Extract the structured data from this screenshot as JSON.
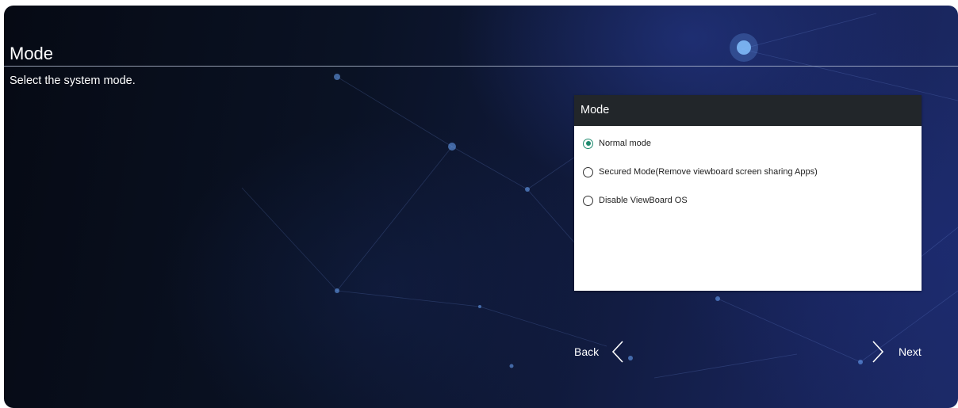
{
  "page": {
    "title": "Mode",
    "subtitle": "Select the system mode."
  },
  "dialog": {
    "title": "Mode",
    "options": [
      {
        "label": "Normal mode",
        "selected": true
      },
      {
        "label": "Secured Mode(Remove viewboard screen sharing Apps)",
        "selected": false
      },
      {
        "label": "Disable ViewBoard OS",
        "selected": false
      }
    ]
  },
  "navigation": {
    "back_label": "Back",
    "next_label": "Next",
    "back_icon": "chevron-left-icon",
    "next_icon": "chevron-right-icon"
  },
  "colors": {
    "radio_selected": "#1f8a6e",
    "dialog_header": "#22262a"
  }
}
